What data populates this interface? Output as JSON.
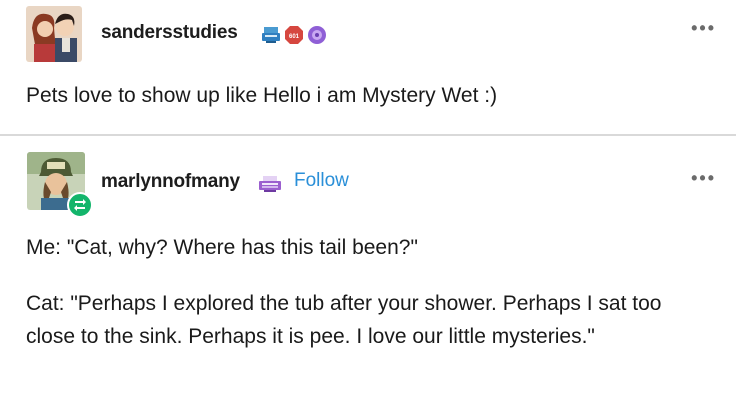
{
  "post1": {
    "username": "sandersstudies",
    "body": "Pets love to show up like Hello i am Mystery Wet :)",
    "menu": "•••"
  },
  "post2": {
    "username": "marlynnofmany",
    "follow": "Follow",
    "menu": "•••",
    "line1": "Me: \"Cat, why? Where has this tail been?\"",
    "line2": "Cat: \"Perhaps I explored the tub after your shower. Perhaps I sat too close to the sink. Perhaps it is pee. I love our little mysteries.\""
  },
  "colors": {
    "follow": "#2a8fd8",
    "reblog": "#13b56b"
  }
}
